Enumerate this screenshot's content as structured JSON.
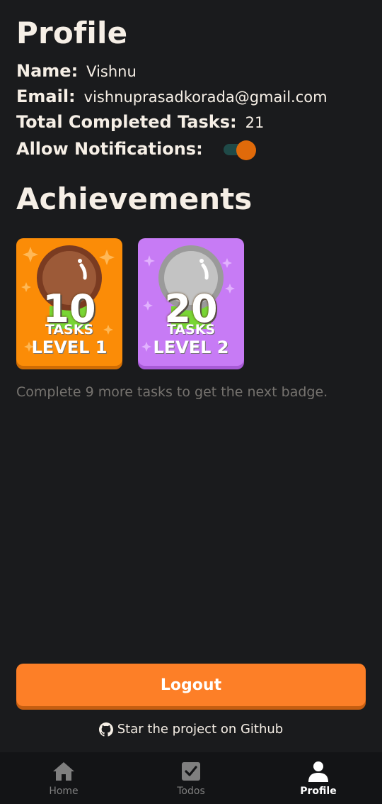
{
  "profile": {
    "title": "Profile",
    "name_label": "Name:",
    "name_value": "Vishnu",
    "email_label": "Email:",
    "email_value": "vishnuprasadkorada@gmail.com",
    "total_label": "Total Completed Tasks:",
    "total_value": "21",
    "notifications_label": "Allow Notifications:",
    "notifications_enabled": true
  },
  "achievements": {
    "title": "Achievements",
    "badges": [
      {
        "number": "10",
        "tasks_label": "TASKS",
        "level": "LEVEL 1",
        "color": "#fb8c07",
        "medal": "bronze-medal-icon"
      },
      {
        "number": "20",
        "tasks_label": "TASKS",
        "level": "LEVEL 2",
        "color": "#c77bf5",
        "medal": "silver-medal-icon"
      }
    ],
    "hint": "Complete 9 more tasks to get the next badge."
  },
  "actions": {
    "logout_label": "Logout",
    "github_text": "Star the project on Github"
  },
  "nav": {
    "items": [
      {
        "label": "Home",
        "icon": "home-icon",
        "active": false
      },
      {
        "label": "Todos",
        "icon": "checkbox-icon",
        "active": false
      },
      {
        "label": "Profile",
        "icon": "person-icon",
        "active": true
      }
    ]
  },
  "colors": {
    "background": "#1a1b1d",
    "accent": "#fd7f27",
    "toggle_thumb": "#e06a0a",
    "text": "#f6efe6",
    "muted": "#76736f"
  }
}
